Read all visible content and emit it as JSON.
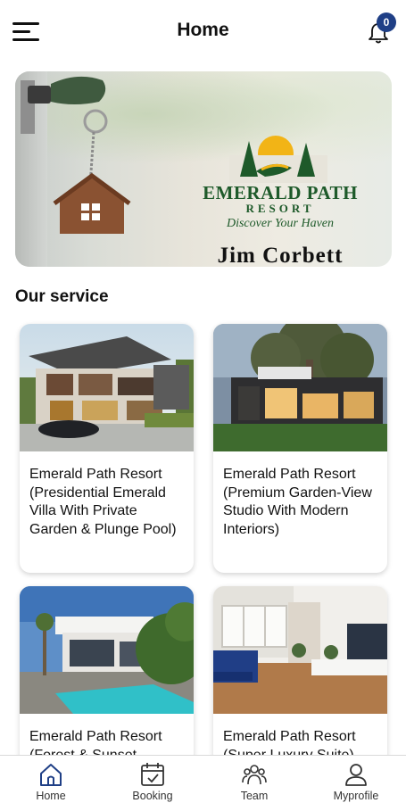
{
  "header": {
    "title": "Home",
    "notification_count": "0"
  },
  "banner": {
    "logo_name": "EMERALD PATH",
    "logo_sub": "RESORT",
    "tagline": "Discover Your Haven",
    "location": "Jim Corbett"
  },
  "section": {
    "title": "Our service"
  },
  "services": [
    {
      "title": "Emerald Path Resort (Presidential Emerald Villa With Private Garden & Plunge Pool)"
    },
    {
      "title": "Emerald Path Resort (Premium Garden-View Studio With Modern Interiors)"
    },
    {
      "title": "Emerald Path Resort (Forest & Sunset"
    },
    {
      "title": "Emerald Path Resort (Super Luxury Suite)"
    }
  ],
  "bottom_nav": {
    "items": [
      {
        "label": "Home",
        "icon": "home-icon"
      },
      {
        "label": "Booking",
        "icon": "calendar-check-icon"
      },
      {
        "label": "Team",
        "icon": "team-icon"
      },
      {
        "label": "Myprofile",
        "icon": "user-icon"
      }
    ]
  },
  "colors": {
    "badge": "#1f3f86",
    "logo_green": "#1e5a2a"
  }
}
